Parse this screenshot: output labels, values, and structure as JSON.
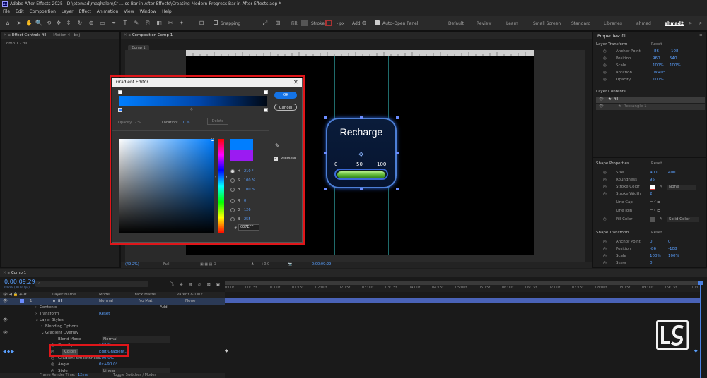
{
  "window": {
    "title": "Adobe After Effects 2025 - D:\\etemad\\maghaleh\\Cr ... ss Bar in After Effects\\Creating-Modern-Progress-Bar-in-After Effects.aep *"
  },
  "menu": [
    "File",
    "Edit",
    "Composition",
    "Layer",
    "Effect",
    "Animation",
    "View",
    "Window",
    "Help"
  ],
  "toolbar": {
    "snapping": "Snapping",
    "fill": "Fill:",
    "stroke": "Stroke:",
    "stroke_px": "- px",
    "add": "Add:",
    "auto_open": "Auto-Open Panel"
  },
  "workspaces": [
    "Default",
    "Review",
    "Learn",
    "Small Screen",
    "Standard",
    "Libraries",
    "ahmad",
    "ahmad2"
  ],
  "left_panel": {
    "tabs": [
      "Effect Controls fill",
      "Motion 4 - bdj"
    ],
    "subtitle": "Comp 1 - fill"
  },
  "comp_panel": {
    "tab": "Composition Comp 1",
    "subtab": "Comp 1",
    "zoom": "(49.2%)",
    "resolution": "Full",
    "exposure": "+0.0",
    "timecode": "0:00:09:29"
  },
  "widget": {
    "title": "Recharge",
    "scale": [
      "0",
      "50",
      "100"
    ]
  },
  "gradient_editor": {
    "title": "Gradient Editor",
    "ok": "OK",
    "cancel": "Cancel",
    "opacity_label": "Opacity:",
    "opacity_value": "- %",
    "location_label": "Location:",
    "location_value": "0 %",
    "delete": "Delete",
    "preview": "Preview",
    "h_label": "H",
    "h_value": "210 °",
    "s_label": "S",
    "s_value": "100 %",
    "b_label": "B",
    "b_value": "100 %",
    "r_label": "R",
    "r_value": "0",
    "g_label": "G",
    "g_value": "126",
    "b2_label": "B",
    "b2_value": "255",
    "hex_label": "#",
    "hex_value": "007EFF",
    "colors": {
      "new": "#007eff",
      "old": "#9b1bf2"
    }
  },
  "properties": {
    "header": "Properties: fill",
    "layer_transform": "Layer Transform",
    "reset": "Reset",
    "anchor_point": "Anchor Point",
    "anchor_vals": [
      "-86",
      "-108"
    ],
    "position": "Position",
    "position_vals": [
      "960",
      "540"
    ],
    "scale": "Scale",
    "scale_vals": [
      "100%",
      "100%"
    ],
    "rotation": "Rotation",
    "rotation_val": "0x+0°",
    "opacity": "Opacity",
    "opacity_val": "100%",
    "layer_contents": "Layer Contents",
    "layer_item": "fill",
    "sub_item": "Rectangle 1",
    "shape_properties": "Shape Properties",
    "size": "Size",
    "size_vals": [
      "400",
      "400"
    ],
    "roundness": "Roundness",
    "roundness_val": "95",
    "stroke_color": "Stroke Color",
    "stroke_sel": "None",
    "stroke_width": "Stroke Width",
    "stroke_width_val": "2",
    "line_cap": "Line Cap",
    "line_join": "Line Join",
    "fill_color": "Fill Color",
    "fill_sel": "Solid Color",
    "shape_transform": "Shape Transform",
    "s_anchor": "Anchor Point",
    "s_anchor_vals": [
      "0",
      "0"
    ],
    "s_position": "Position",
    "s_position_vals": [
      "-86",
      "-108"
    ],
    "s_scale": "Scale",
    "s_scale_vals": [
      "100%",
      "100%"
    ],
    "skew": "Skew",
    "skew_val": "0"
  },
  "timeline": {
    "tab": "Comp 1",
    "timecode": "0:00:09:29",
    "fps": "00299 (30.00 fps)",
    "headers": {
      "layer_name": "Layer Name",
      "mode": "Mode",
      "t": "T",
      "track_matte": "Track Matte",
      "parent": "Parent & Link"
    },
    "layer": {
      "num": "1",
      "name": "fill",
      "mode": "Normal",
      "matte": "No Mat",
      "parent": "None"
    },
    "rows": [
      {
        "label": "Contents",
        "extra": "Add:"
      },
      {
        "label": "Transform",
        "extra": "Reset"
      },
      {
        "label": "Layer Styles",
        "extra": ""
      },
      {
        "label": "Blending Options",
        "extra": ""
      },
      {
        "label": "Gradient Overlay",
        "extra": ""
      },
      {
        "label": "Blend Mode",
        "extra": "Normal"
      },
      {
        "label": "Opacity",
        "extra": "100 %"
      },
      {
        "label": "Colors",
        "extra": "Edit Gradient..."
      },
      {
        "label": "Gradient Smoothness",
        "extra": "100.0%"
      },
      {
        "label": "Angle",
        "extra": "0x+90.0°"
      },
      {
        "label": "Style",
        "extra": "Linear"
      }
    ],
    "ticks": [
      "0:00f",
      "00:15f",
      "01:00f",
      "01:15f",
      "02:00f",
      "02:15f",
      "03:00f",
      "03:15f",
      "04:00f",
      "04:15f",
      "05:00f",
      "05:15f",
      "06:00f",
      "06:15f",
      "07:00f",
      "07:15f",
      "08:00f",
      "08:15f",
      "09:00f",
      "09:15f",
      "10:0"
    ],
    "footer_render": "Frame Render Time:",
    "footer_time": "12ms",
    "footer_toggle": "Toggle Switches / Modes"
  }
}
